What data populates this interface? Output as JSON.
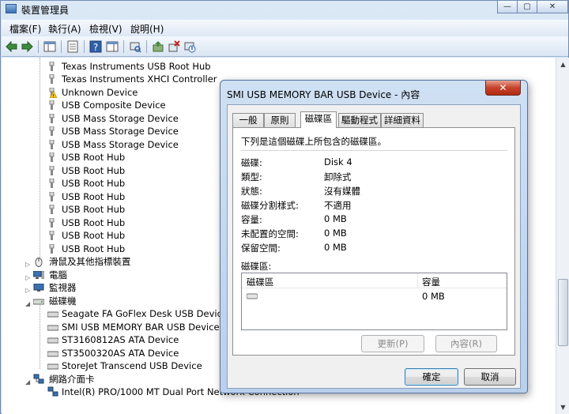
{
  "window": {
    "title": "裝置管理員",
    "controls": [
      "—",
      "▢",
      "✕"
    ]
  },
  "menu": [
    "檔案(F)",
    "執行(A)",
    "檢視(V)",
    "說明(H)"
  ],
  "toolbar_icons": [
    "back-arrow-icon",
    "forward-arrow-icon",
    "show-hide-console-tree-icon",
    "properties-icon",
    "help-icon",
    "action-pane-icon",
    "scan-hardware-icon",
    "update-driver-icon",
    "uninstall-icon",
    "disable-device-icon"
  ],
  "tree": {
    "usb_children": [
      "Texas Instruments USB Root Hub",
      "Texas Instruments XHCI Controller",
      "Unknown Device",
      "USB Composite Device",
      "USB Mass Storage Device",
      "USB Mass Storage Device",
      "USB Mass Storage Device",
      "USB Root Hub",
      "USB Root Hub",
      "USB Root Hub",
      "USB Root Hub",
      "USB Root Hub",
      "USB Root Hub",
      "USB Root Hub",
      "USB Root Hub"
    ],
    "mice": "滑鼠及其他指標裝置",
    "computer": "電腦",
    "monitors": "監視器",
    "disk_drives": "磁碟機",
    "disk_children": [
      "Seagate FA GoFlex Desk USB Device",
      "SMI USB MEMORY BAR USB Device",
      "ST3160812AS ATA Device",
      "ST3500320AS ATA Device",
      "StoreJet Transcend USB Device"
    ],
    "network": "網路介面卡",
    "network_child": "Intel(R) PRO/1000 MT Dual Port Network Connection"
  },
  "dialog": {
    "title": "SMI USB MEMORY BAR USB Device - 內容",
    "close": "✕",
    "tabs": [
      "一般",
      "原則",
      "磁碟區",
      "驅動程式",
      "詳細資料"
    ],
    "active_tab": "磁碟區",
    "description": "下列是這個磁碟上所包含的磁碟區。",
    "properties": [
      {
        "label": "磁碟:",
        "value": "Disk 4"
      },
      {
        "label": "類型:",
        "value": "卸除式"
      },
      {
        "label": "狀態:",
        "value": "沒有媒體"
      },
      {
        "label": "磁碟分割樣式:",
        "value": "不適用"
      },
      {
        "label": "容量:",
        "value": "0 MB"
      },
      {
        "label": "未配置的空間:",
        "value": "0 MB"
      },
      {
        "label": "保留空間:",
        "value": "0 MB"
      }
    ],
    "volumes_label": "磁碟區:",
    "volumes_columns": [
      "磁碟區",
      "容量"
    ],
    "volumes_rows": [
      {
        "name": "",
        "capacity": "0 MB"
      }
    ],
    "update_button": "更新(P)",
    "properties_button": "內容(R)",
    "ok_button": "確定",
    "cancel_button": "取消"
  }
}
